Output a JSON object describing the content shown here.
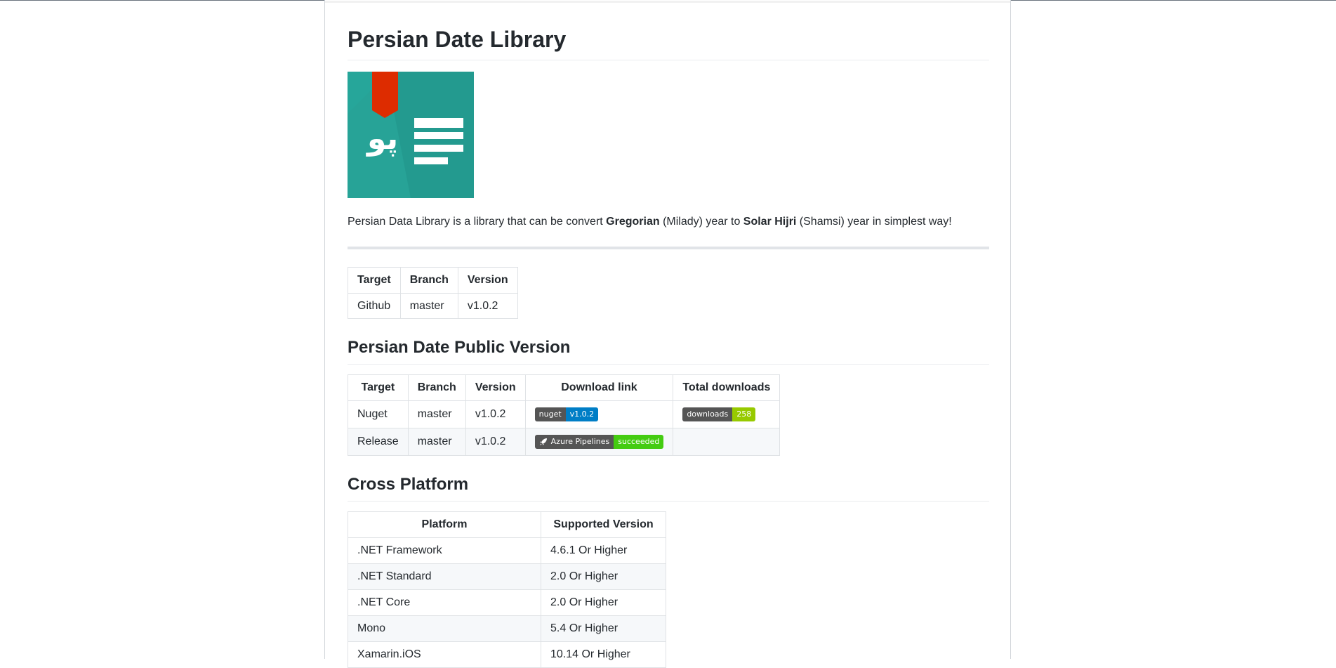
{
  "header": {
    "title": "Persian Date Library"
  },
  "intro": {
    "part1": "Persian Data Library is a library that can be convert ",
    "gregorian": "Gregorian",
    "part2": " (Milady) year to ",
    "solar": "Solar Hijri",
    "part3": " (Shamsi) year in simplest way!"
  },
  "logo": {
    "glyph": "پو",
    "bg": "#26A69A",
    "ribbon": "#DD2C00"
  },
  "table1": {
    "headers": [
      "Target",
      "Branch",
      "Version"
    ],
    "rows": [
      [
        "Github",
        "master",
        "v1.0.2"
      ]
    ]
  },
  "section_public": {
    "title": "Persian Date Public Version",
    "headers": [
      "Target",
      "Branch",
      "Version",
      "Download link",
      "Total downloads"
    ],
    "rows": [
      {
        "target": "Nuget",
        "branch": "master",
        "version": "v1.0.2"
      },
      {
        "target": "Release",
        "branch": "master",
        "version": "v1.0.2"
      }
    ],
    "nuget_badge": {
      "left": "nuget",
      "right": "v1.0.2"
    },
    "downloads_badge": {
      "left": "downloads",
      "right": "258"
    },
    "pipeline_badge": {
      "left": "Azure Pipelines",
      "right": "succeeded",
      "icon": "rocket-icon"
    }
  },
  "section_platform": {
    "title": "Cross Platform",
    "headers": [
      "Platform",
      "Supported Version"
    ],
    "rows": [
      [
        ".NET Framework",
        "4.6.1 Or Higher"
      ],
      [
        ".NET Standard",
        "2.0 Or Higher"
      ],
      [
        ".NET Core",
        "2.0 Or Higher"
      ],
      [
        "Mono",
        "5.4 Or Higher"
      ],
      [
        "Xamarin.iOS",
        "10.14 Or Higher"
      ]
    ]
  }
}
